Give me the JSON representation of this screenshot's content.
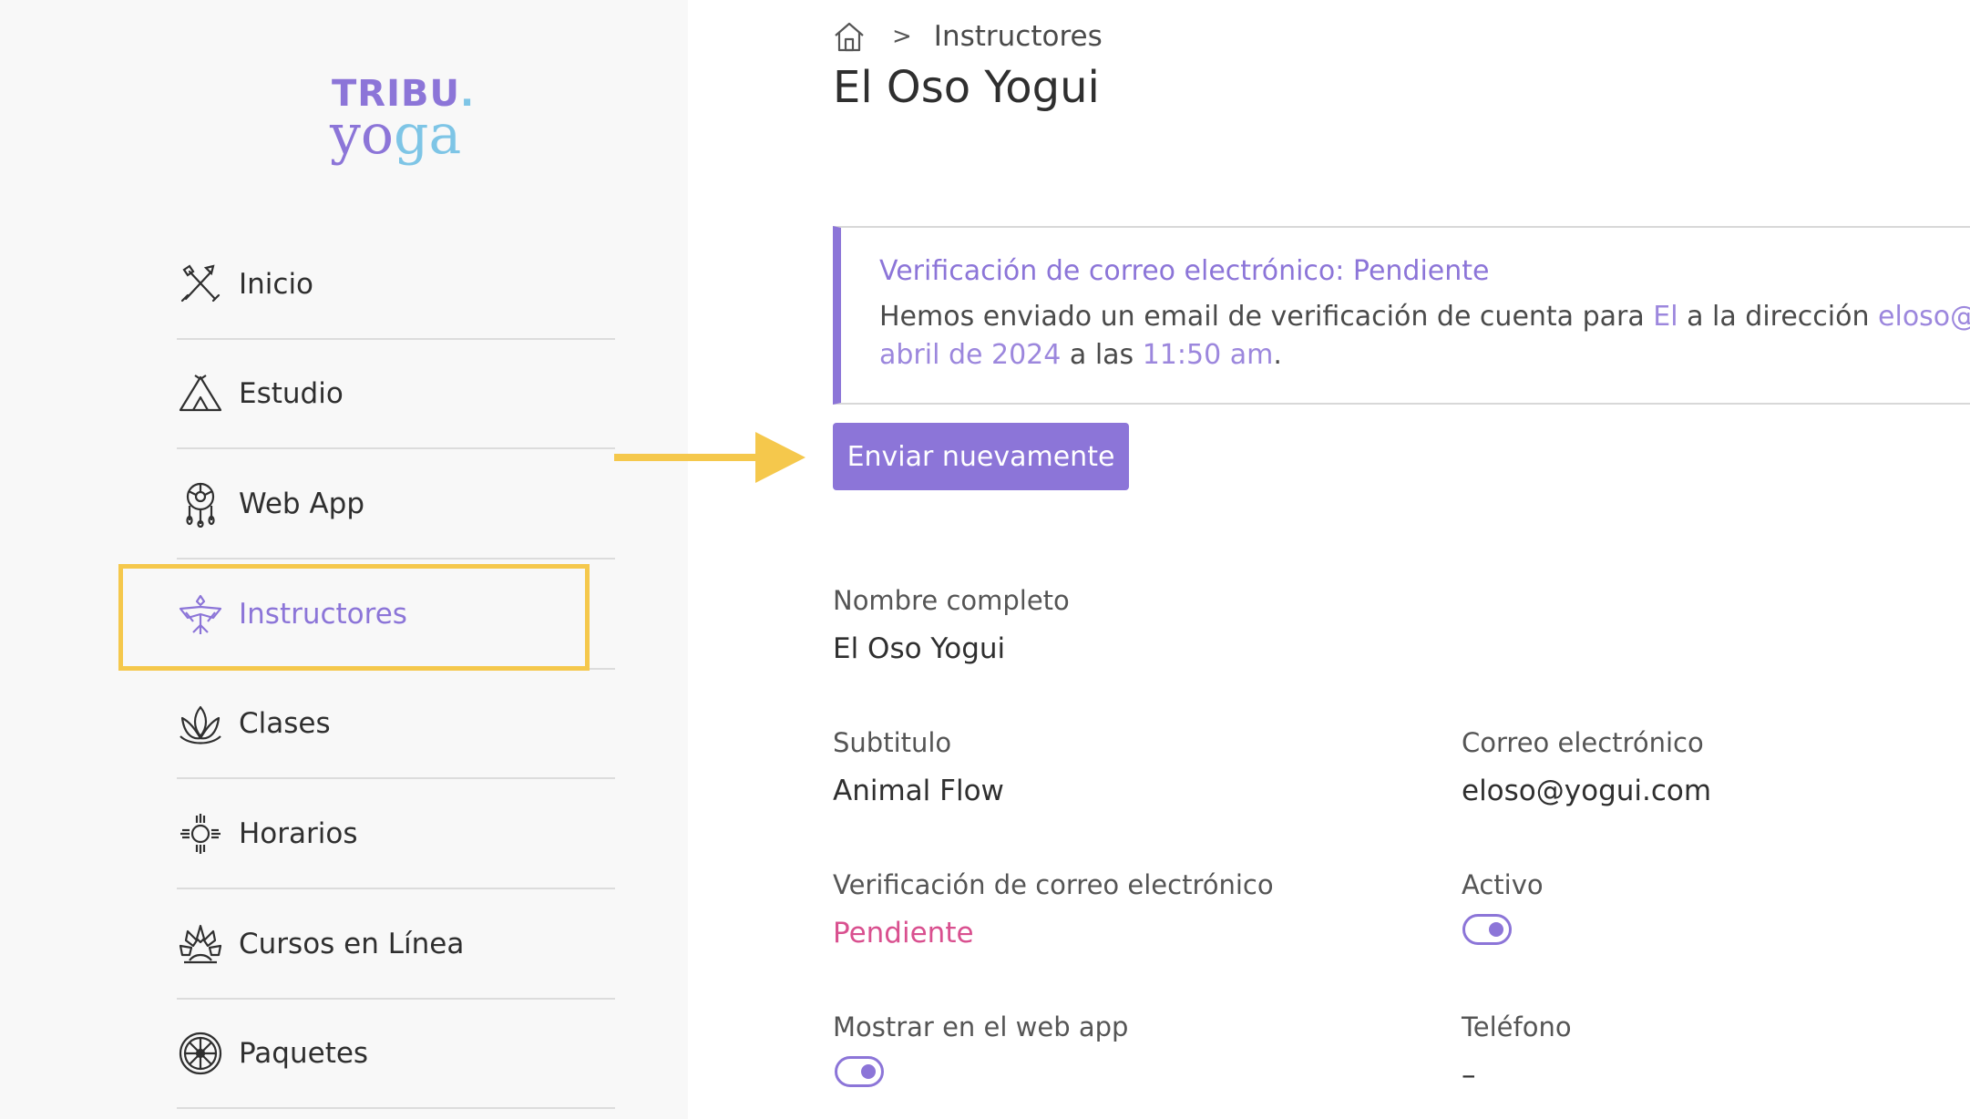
{
  "brand": {
    "logo_top": "TRIBU",
    "logo_dot": ".",
    "logo_y": "y",
    "logo_o": "o",
    "logo_ga": "ga"
  },
  "sidebar": {
    "items": [
      {
        "label": "Inicio",
        "icon": "tools-icon"
      },
      {
        "label": "Estudio",
        "icon": "tent-icon"
      },
      {
        "label": "Web App",
        "icon": "dreamcatcher-icon"
      },
      {
        "label": "Instructores",
        "icon": "thunderbird-icon",
        "active": true
      },
      {
        "label": "Clases",
        "icon": "lotus-icon"
      },
      {
        "label": "Horarios",
        "icon": "sun-icon"
      },
      {
        "label": "Cursos en Línea",
        "icon": "headdress-icon"
      },
      {
        "label": "Paquetes",
        "icon": "wheel-icon"
      }
    ]
  },
  "breadcrumb": {
    "home_icon": "home-icon",
    "separator": ">",
    "current": "Instructores"
  },
  "page": {
    "title": "El Oso Yogui"
  },
  "alert": {
    "title": "Verificación de correo electrónico: Pendiente",
    "line1_a": "Hemos enviado un email de verificación de cuenta para ",
    "line1_name": "El",
    "line1_b": " a la dirección ",
    "line1_email": "eloso@yogui",
    "line2_date": "abril de 2024",
    "line2_b": " a las ",
    "line2_time": "11:50 am",
    "line2_end": "."
  },
  "resend_button": "Enviar nuevamente",
  "fields": {
    "full_name_label": "Nombre completo",
    "full_name_value": "El Oso Yogui",
    "subtitle_label": "Subtitulo",
    "subtitle_value": "Animal Flow",
    "email_label": "Correo electrónico",
    "email_value": "eloso@yogui.com",
    "verification_label": "Verificación de correo electrónico",
    "verification_value": "Pendiente",
    "active_label": "Activo",
    "active_on": true,
    "show_webapp_label": "Mostrar en el web app",
    "show_webapp_on": true,
    "phone_label": "Teléfono",
    "phone_value": "–"
  },
  "colors": {
    "accent": "#8c75d8",
    "highlight": "#f5c84c",
    "pending": "#d9508f",
    "logo_blue": "#7ec5e6"
  }
}
